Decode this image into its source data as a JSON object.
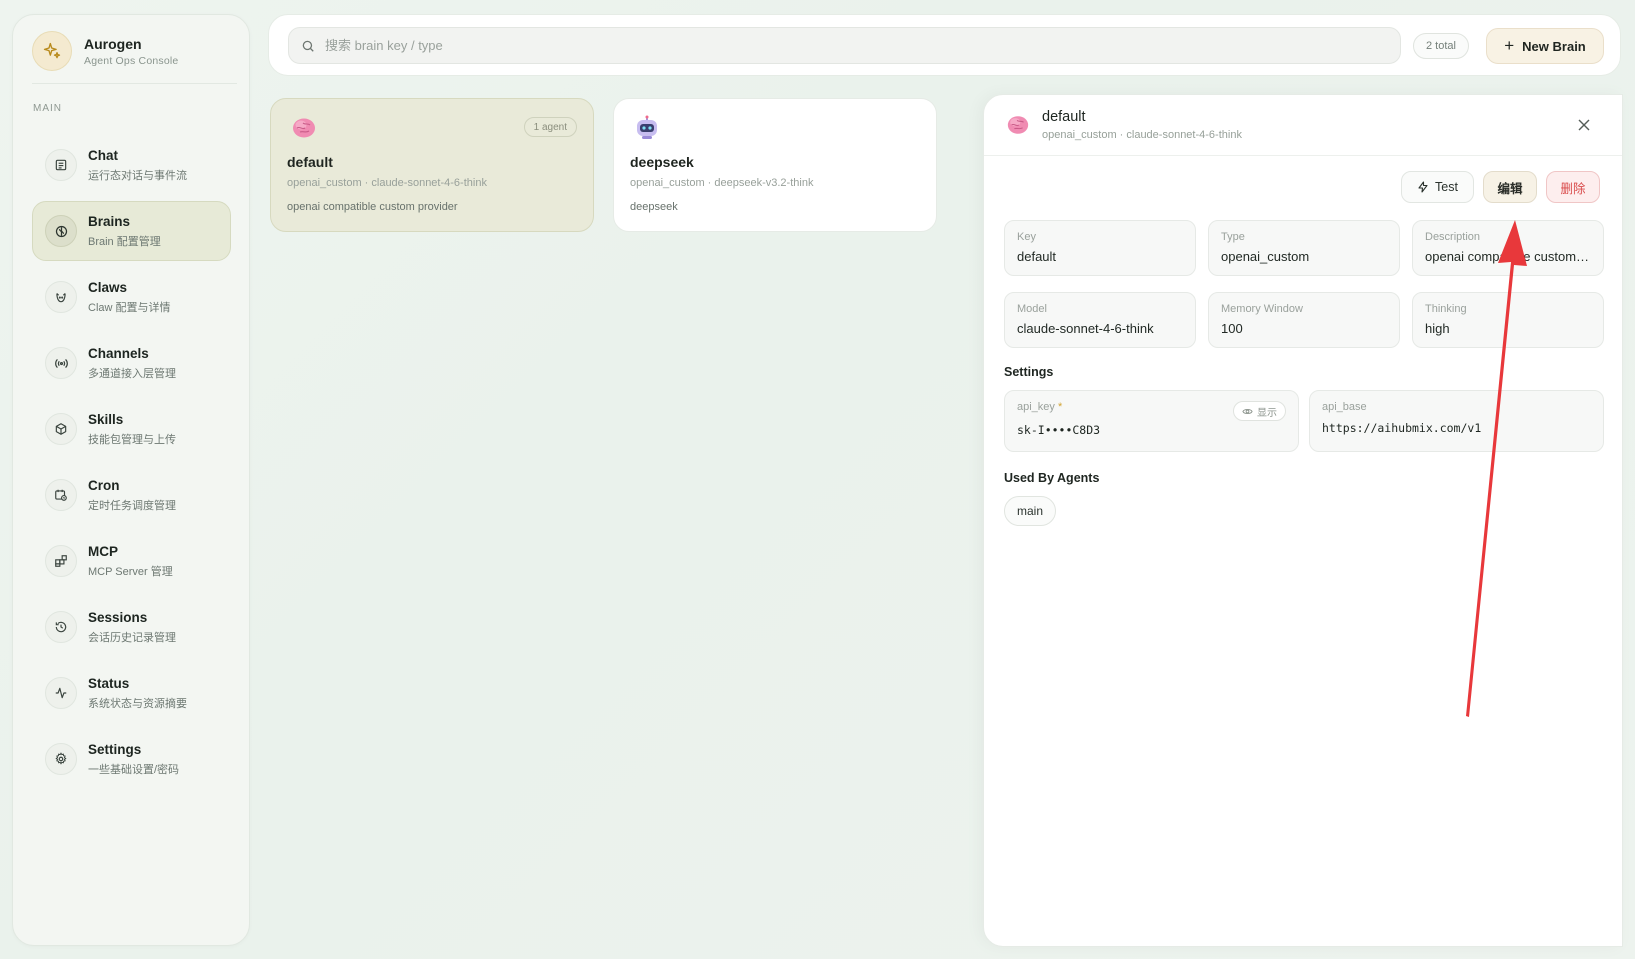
{
  "brand": {
    "title": "Aurogen",
    "subtitle": "Agent Ops Console"
  },
  "nav": {
    "section": "MAIN",
    "items": [
      {
        "label": "Chat",
        "sub": "运行态对话与事件流",
        "icon": "chat-icon"
      },
      {
        "label": "Brains",
        "sub": "Brain 配置管理",
        "icon": "brain-icon",
        "active": true
      },
      {
        "label": "Claws",
        "sub": "Claw 配置与详情",
        "icon": "claw-icon"
      },
      {
        "label": "Channels",
        "sub": "多通道接入层管理",
        "icon": "broadcast-icon"
      },
      {
        "label": "Skills",
        "sub": "技能包管理与上传",
        "icon": "package-icon"
      },
      {
        "label": "Cron",
        "sub": "定时任务调度管理",
        "icon": "calendar-clock-icon"
      },
      {
        "label": "MCP",
        "sub": "MCP Server 管理",
        "icon": "blocks-icon"
      },
      {
        "label": "Sessions",
        "sub": "会话历史记录管理",
        "icon": "history-icon"
      },
      {
        "label": "Status",
        "sub": "系统状态与资源摘要",
        "icon": "activity-icon"
      },
      {
        "label": "Settings",
        "sub": "一些基础设置/密码",
        "icon": "gear-icon"
      }
    ]
  },
  "search": {
    "placeholder": "搜索 brain key / type",
    "value": ""
  },
  "total": "2 total",
  "new_brain_label": "New Brain",
  "brains": [
    {
      "title": "default",
      "meta": "openai_custom · claude-sonnet-4-6-think",
      "desc": "openai compatible custom provider",
      "badge": "1 agent",
      "icon": "brain-emoji-icon"
    },
    {
      "title": "deepseek",
      "meta": "openai_custom · deepseek-v3.2-think",
      "desc": "deepseek",
      "badge": "",
      "icon": "robot-emoji-icon"
    }
  ],
  "detail": {
    "title": "default",
    "meta": "openai_custom · claude-sonnet-4-6-think",
    "actions": {
      "test": "Test",
      "edit": "编辑",
      "delete": "删除"
    },
    "fields": {
      "key": {
        "label": "Key",
        "value": "default"
      },
      "type": {
        "label": "Type",
        "value": "openai_custom"
      },
      "description": {
        "label": "Description",
        "value": "openai compatible custom provider"
      },
      "model": {
        "label": "Model",
        "value": "claude-sonnet-4-6-think"
      },
      "memory_window": {
        "label": "Memory Window",
        "value": "100"
      },
      "thinking": {
        "label": "Thinking",
        "value": "high"
      }
    },
    "settings_title": "Settings",
    "settings": {
      "api_key": {
        "label": "api_key",
        "required": "*",
        "value": "sk-I••••C8D3",
        "reveal": "显示"
      },
      "api_base": {
        "label": "api_base",
        "value": "https://aihubmix.com/v1"
      }
    },
    "used_by_title": "Used By Agents",
    "used_by": [
      "main"
    ]
  },
  "colors": {
    "accent_bg": "#e9ead9",
    "danger": "#d94b4b",
    "annotation_arrow": "#e8383b"
  }
}
